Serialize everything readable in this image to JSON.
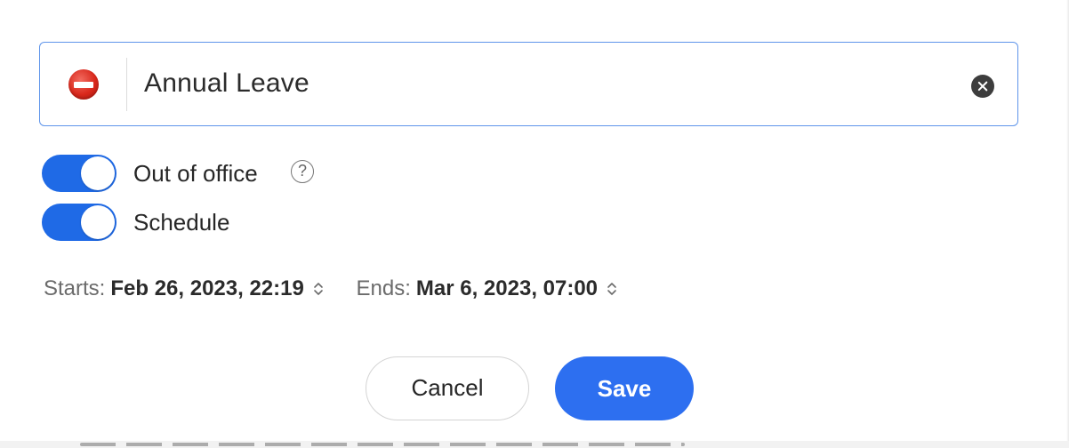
{
  "status": {
    "emoji_icon": "no-entry-icon",
    "text": "Annual Leave",
    "clear_icon": "clear-circle-x-icon"
  },
  "toggles": [
    {
      "label": "Out of office",
      "on": true,
      "has_help": true,
      "help_glyph": "?"
    },
    {
      "label": "Schedule",
      "on": true
    }
  ],
  "schedule": {
    "starts_label": "Starts:",
    "starts_value": "Feb 26, 2023, 22:19",
    "ends_label": "Ends:",
    "ends_value": "Mar 6, 2023, 07:00",
    "stepper_icon": "up-down-chevron-icon"
  },
  "buttons": {
    "cancel_label": "Cancel",
    "save_label": "Save"
  },
  "colors": {
    "accent": "#1f6ae6",
    "save_button": "#2d6ff0",
    "input_border": "#5f95ea",
    "emoji_red": "#d9281c"
  }
}
